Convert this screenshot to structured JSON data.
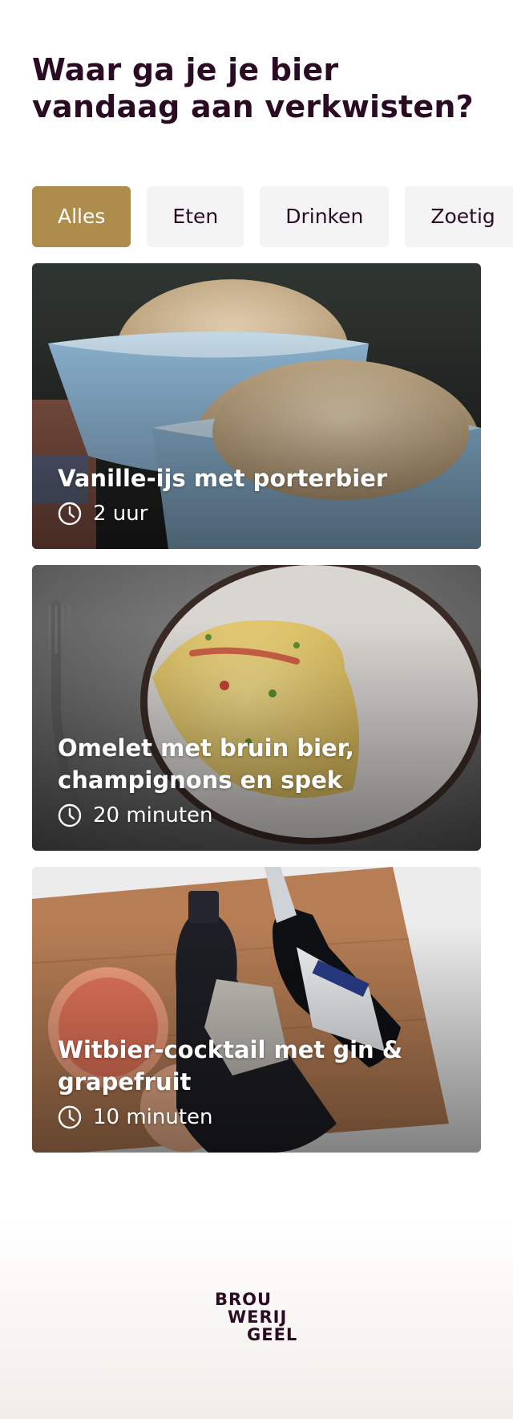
{
  "header": {
    "title": "Waar ga je je bier vandaag aan verkwisten?"
  },
  "filters": {
    "active": "Alles",
    "items": [
      {
        "label": "Alles"
      },
      {
        "label": "Eten"
      },
      {
        "label": "Drinken"
      },
      {
        "label": "Zoetig"
      }
    ]
  },
  "recipes": [
    {
      "title": "Vanille-ijs met porterbier",
      "time": "2 uur",
      "icon": "clock-icon"
    },
    {
      "title": "Omelet met bruin bier, champignons en spek",
      "time": "20 minuten",
      "icon": "clock-icon"
    },
    {
      "title": "Witbier-cocktail met gin & grapefruit",
      "time": "10 minuten",
      "icon": "clock-icon"
    }
  ],
  "footer": {
    "logo_lines": [
      "BROU",
      "WERIJ",
      "GEEL"
    ]
  },
  "colors": {
    "accent": "#ae8c4c",
    "text": "#2b0b23",
    "chip_bg": "#f4f4f4"
  }
}
